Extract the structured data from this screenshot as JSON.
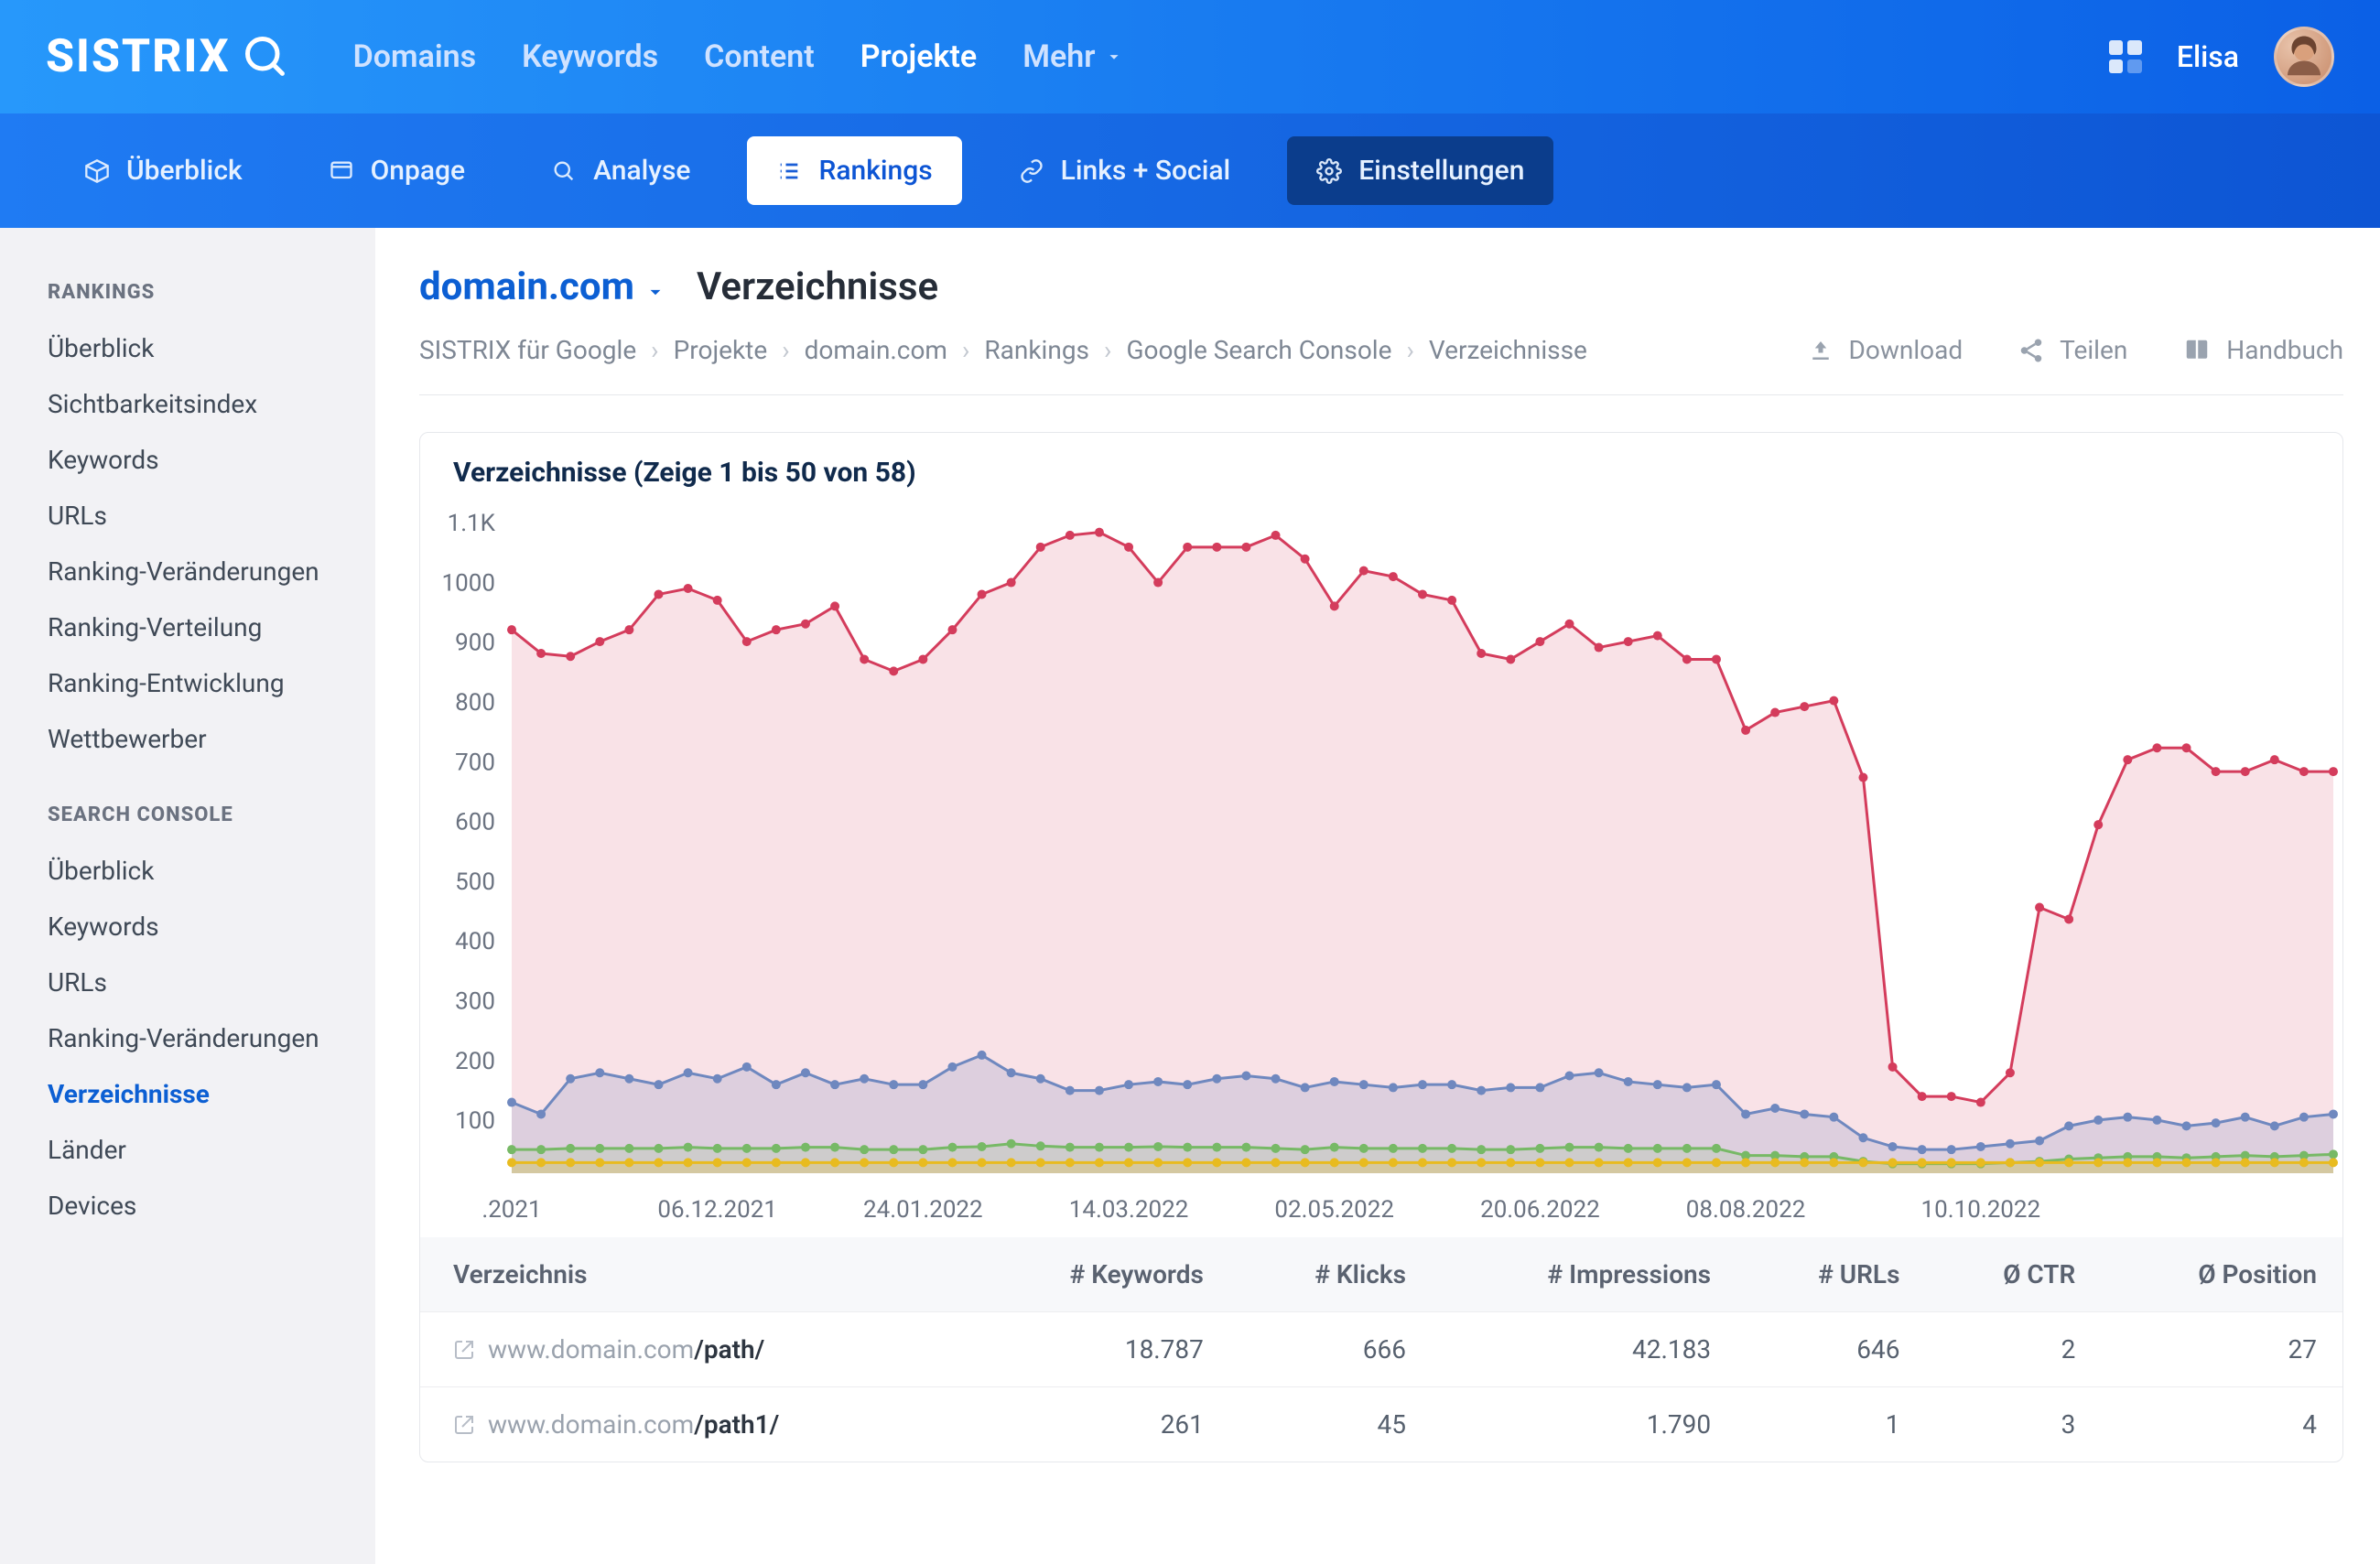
{
  "topnav": {
    "brand": "SISTRIX",
    "items": [
      "Domains",
      "Keywords",
      "Content",
      "Projekte",
      "Mehr"
    ],
    "active_index": 3,
    "user_name": "Elisa"
  },
  "subnav": {
    "tabs": [
      "Überblick",
      "Onpage",
      "Analyse",
      "Rankings",
      "Links + Social",
      "Einstellungen"
    ],
    "active_index": 3
  },
  "sidebar": {
    "groups": [
      {
        "heading": "RANKINGS",
        "items": [
          "Überblick",
          "Sichtbarkeitsindex",
          "Keywords",
          "URLs",
          "Ranking-Veränderungen",
          "Ranking-Verteilung",
          "Ranking-Entwicklung",
          "Wettbewerber"
        ]
      },
      {
        "heading": "SEARCH CONSOLE",
        "items": [
          "Überblick",
          "Keywords",
          "URLs",
          "Ranking-Veränderungen",
          "Verzeichnisse",
          "Länder",
          "Devices"
        ],
        "active_index": 4
      }
    ]
  },
  "page_head": {
    "domain": "domain.com",
    "title": "Verzeichnisse",
    "breadcrumbs": [
      "SISTRIX für Google",
      "Projekte",
      "domain.com",
      "Rankings",
      "Google Search Console",
      "Verzeichnisse"
    ],
    "actions": [
      "Download",
      "Teilen",
      "Handbuch"
    ]
  },
  "card": {
    "title": "Verzeichnisse (Zeige 1 bis 50 von 58)"
  },
  "table": {
    "headers": [
      "Verzeichnis",
      "# Keywords",
      "# Klicks",
      "# Impressions",
      "# URLs",
      "Ø CTR",
      "Ø Position"
    ],
    "rows": [
      {
        "host": "www.domain.com",
        "path": "/path/",
        "keywords": "18.787",
        "clicks": "666",
        "impressions": "42.183",
        "urls": "646",
        "ctr": "2",
        "position": "27"
      },
      {
        "host": "www.domain.com",
        "path": "/path1/",
        "keywords": "261",
        "clicks": "45",
        "impressions": "1.790",
        "urls": "1",
        "ctr": "3",
        "position": "4"
      }
    ]
  },
  "chart_data": {
    "type": "line",
    "xlabel": "",
    "ylabel": "",
    "ylim": [
      0,
      1100
    ],
    "y_ticks": [
      "1.1K",
      "1000",
      "900",
      "800",
      "700",
      "600",
      "500",
      "400",
      "300",
      "200",
      "100"
    ],
    "x_tick_labels": [
      ".2021",
      "06.12.2021",
      "24.01.2022",
      "14.03.2022",
      "02.05.2022",
      "20.06.2022",
      "08.08.2022",
      "10.10.2022"
    ],
    "x_tick_positions": [
      0,
      7,
      14,
      21,
      28,
      35,
      42,
      50
    ],
    "n_points": 54,
    "series": [
      {
        "name": "red",
        "color": "#d43c5c",
        "fill": "rgba(212,60,92,0.15)",
        "values": [
          920,
          880,
          875,
          900,
          920,
          980,
          990,
          970,
          900,
          920,
          930,
          960,
          870,
          850,
          870,
          920,
          980,
          1000,
          1060,
          1080,
          1085,
          1060,
          1000,
          1060,
          1060,
          1060,
          1080,
          1040,
          960,
          1020,
          1010,
          980,
          970,
          880,
          870,
          900,
          930,
          890,
          900,
          910,
          870,
          870,
          750,
          780,
          790,
          800,
          670,
          180,
          130,
          130,
          120,
          170,
          450,
          430,
          590,
          700,
          720,
          720,
          680,
          680,
          700,
          680,
          680
        ]
      },
      {
        "name": "blue",
        "color": "#6f88bf",
        "fill": "rgba(111,136,191,0.20)",
        "values": [
          120,
          100,
          160,
          170,
          160,
          150,
          170,
          160,
          180,
          150,
          170,
          150,
          160,
          150,
          150,
          180,
          200,
          170,
          160,
          140,
          140,
          150,
          155,
          150,
          160,
          165,
          160,
          145,
          155,
          150,
          145,
          150,
          150,
          140,
          145,
          145,
          165,
          170,
          155,
          150,
          145,
          150,
          100,
          110,
          100,
          95,
          60,
          45,
          40,
          40,
          45,
          50,
          55,
          80,
          90,
          95,
          90,
          80,
          85,
          95,
          80,
          95,
          100
        ]
      },
      {
        "name": "green",
        "color": "#77b966",
        "fill": "rgba(119,185,102,0.15)",
        "values": [
          40,
          40,
          42,
          42,
          42,
          42,
          44,
          42,
          42,
          42,
          44,
          44,
          40,
          40,
          40,
          44,
          45,
          50,
          46,
          44,
          44,
          44,
          45,
          44,
          44,
          44,
          42,
          40,
          44,
          42,
          42,
          42,
          42,
          40,
          40,
          42,
          44,
          44,
          42,
          42,
          42,
          42,
          30,
          30,
          28,
          28,
          20,
          16,
          16,
          16,
          16,
          18,
          20,
          24,
          26,
          28,
          28,
          26,
          28,
          30,
          28,
          30,
          32
        ]
      },
      {
        "name": "yellow",
        "color": "#e8bb1f",
        "fill": "rgba(232,187,31,0.25)",
        "values": [
          18,
          18,
          18,
          18,
          18,
          18,
          18,
          18,
          18,
          18,
          18,
          18,
          18,
          18,
          18,
          18,
          18,
          18,
          18,
          18,
          18,
          18,
          18,
          18,
          18,
          18,
          18,
          18,
          18,
          18,
          18,
          18,
          18,
          18,
          18,
          18,
          18,
          18,
          18,
          18,
          18,
          18,
          18,
          18,
          18,
          18,
          18,
          18,
          18,
          18,
          18,
          18,
          18,
          18,
          18,
          18,
          18,
          18,
          18,
          18,
          18,
          18,
          18
        ]
      }
    ]
  }
}
